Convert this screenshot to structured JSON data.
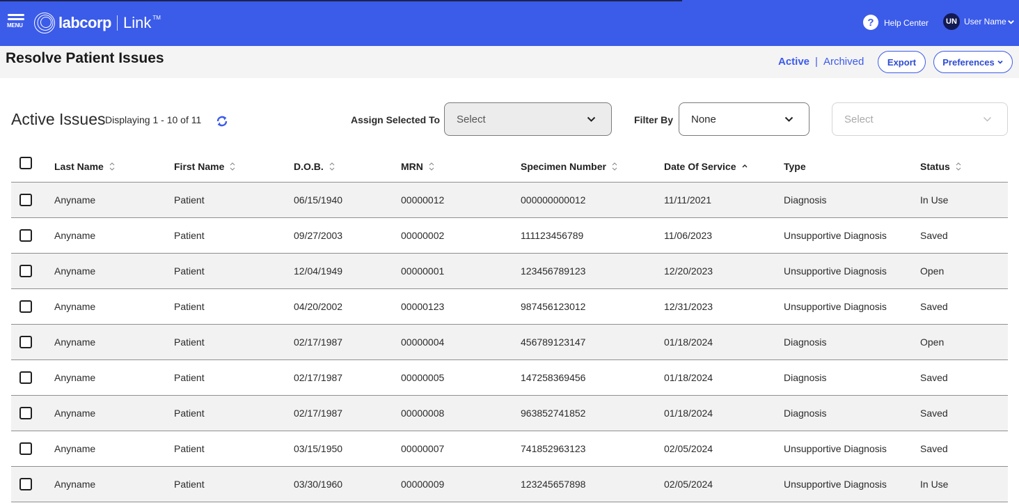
{
  "header": {
    "menu_label": "MENU",
    "brand": "labcorp",
    "product": "Link",
    "trademark": "TM",
    "help_label": "Help Center",
    "user_initials": "UN",
    "user_name": "User Name",
    "brand_color": "#3b5be9"
  },
  "subheader": {
    "title": "Resolve Patient Issues",
    "view_active": "Active",
    "view_separator": "|",
    "view_archived": "Archived",
    "export_label": "Export",
    "preferences_label": "Preferences"
  },
  "toolbar": {
    "section_title": "Active Issues",
    "displaying": "Displaying 1 - 10 of 11",
    "assign_label": "Assign Selected To",
    "assign_value": "Select",
    "filter_label": "Filter By",
    "filter_value": "None",
    "filter_sub_placeholder": "Select"
  },
  "table": {
    "columns": [
      {
        "label": "Last Name",
        "sort": "none"
      },
      {
        "label": "First Name",
        "sort": "none"
      },
      {
        "label": "D.O.B.",
        "sort": "none"
      },
      {
        "label": "MRN",
        "sort": "none"
      },
      {
        "label": "Specimen Number",
        "sort": "none"
      },
      {
        "label": "Date Of Service",
        "sort": "ascending"
      },
      {
        "label": "Type",
        "sort": "unsortable"
      },
      {
        "label": "Status",
        "sort": "none"
      }
    ],
    "rows": [
      {
        "last": "Anyname",
        "first": "Patient",
        "dob": "06/15/1940",
        "mrn": "00000012",
        "specimen": "000000000012",
        "dos": "11/11/2021",
        "type": "Diagnosis",
        "status": "In Use"
      },
      {
        "last": "Anyname",
        "first": "Patient",
        "dob": "09/27/2003",
        "mrn": "00000002",
        "specimen": "111123456789",
        "dos": "11/06/2023",
        "type": "Unsupportive Diagnosis",
        "status": "Saved"
      },
      {
        "last": "Anyname",
        "first": "Patient",
        "dob": "12/04/1949",
        "mrn": "00000001",
        "specimen": "123456789123",
        "dos": "12/20/2023",
        "type": "Unsupportive Diagnosis",
        "status": "Open"
      },
      {
        "last": "Anyname",
        "first": "Patient",
        "dob": "04/20/2002",
        "mrn": "00000123",
        "specimen": "987456123012",
        "dos": "12/31/2023",
        "type": "Unsupportive Diagnosis",
        "status": "Saved"
      },
      {
        "last": "Anyname",
        "first": "Patient",
        "dob": "02/17/1987",
        "mrn": "00000004",
        "specimen": "456789123147",
        "dos": "01/18/2024",
        "type": "Diagnosis",
        "status": "Open"
      },
      {
        "last": "Anyname",
        "first": "Patient",
        "dob": "02/17/1987",
        "mrn": "00000005",
        "specimen": "147258369456",
        "dos": "01/18/2024",
        "type": "Diagnosis",
        "status": "Saved"
      },
      {
        "last": "Anyname",
        "first": "Patient",
        "dob": "02/17/1987",
        "mrn": "00000008",
        "specimen": "963852741852",
        "dos": "01/18/2024",
        "type": "Diagnosis",
        "status": "Saved"
      },
      {
        "last": "Anyname",
        "first": "Patient",
        "dob": "03/15/1950",
        "mrn": "00000007",
        "specimen": "741852963123",
        "dos": "02/05/2024",
        "type": "Unsupportive Diagnosis",
        "status": "Saved"
      },
      {
        "last": "Anyname",
        "first": "Patient",
        "dob": "03/30/1960",
        "mrn": "00000009",
        "specimen": "123245657898",
        "dos": "02/05/2024",
        "type": "Unsupportive Diagnosis",
        "status": "In Use"
      }
    ]
  }
}
